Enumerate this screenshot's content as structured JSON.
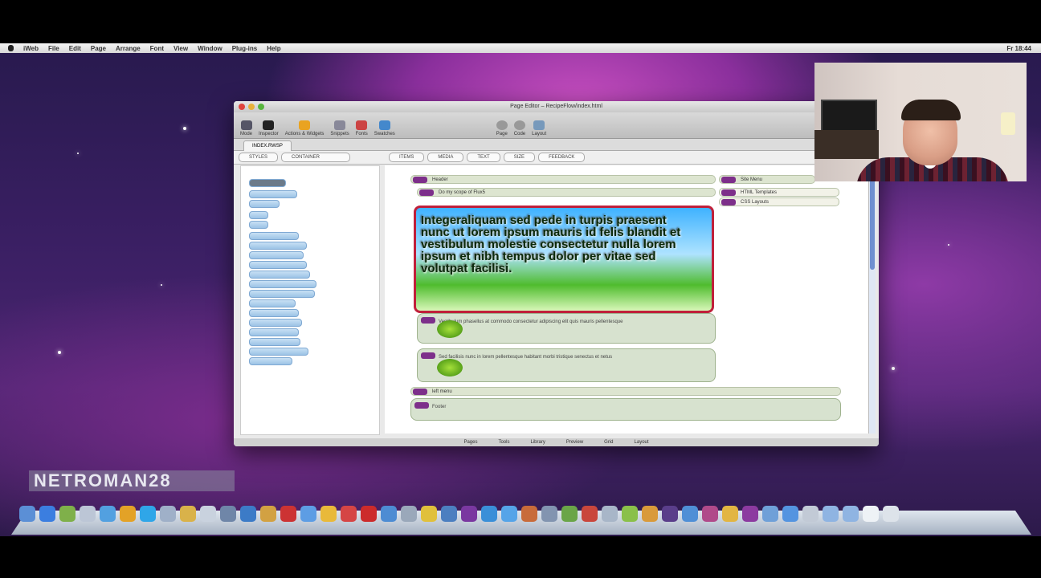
{
  "menubar": {
    "app_menu": "iWeb",
    "items": [
      "File",
      "Edit",
      "Page",
      "Arrange",
      "Font",
      "View",
      "Window",
      "Plug-ins",
      "Help"
    ],
    "clock": "Fr 18:44"
  },
  "window": {
    "title": "Page Editor – RecipeFlow/index.html",
    "toolbar": [
      "Mode",
      "Inspector",
      "Actions & Widgets",
      "Snippets",
      "Fonts",
      "Swatches",
      "Page",
      "Code",
      "Layout"
    ],
    "tab": "INDEX.RWSP",
    "subbar": [
      "STYLES",
      "CONTAINER",
      "ITEMS",
      "MEDIA",
      "TEXT",
      "SIZE",
      "FEEDBACK"
    ],
    "hero_text": "Integeraliquam sed pede in turpis praesent nunc ut lorem ipsum mauris id felis blandit et vestibulum molestie consectetur nulla lorem ipsum et nibh tempus dolor per vitae sed volutpat facilisi.",
    "rows": [
      "Header",
      "Do my scope of Flux5",
      "left menu",
      "Footer"
    ],
    "right_rows": [
      "Site Menu",
      "HTML Templates",
      "CSS Layouts"
    ],
    "paragraph_1": "Vestibulum phasellus at commodo consectetur adipiscing elit quis mauris pellentesque",
    "paragraph_2": "Sed facilisis nunc in lorem pellentesque habitant morbi tristique senectus et netus",
    "status": [
      "Pages",
      "Tools",
      "Library",
      "Preview",
      "Grid",
      "Layout"
    ]
  },
  "watermark": "NETROMAN28",
  "colors": {
    "accent": "#7d2f8a",
    "border": "#c0203a",
    "desktop": "#3a1f63"
  }
}
